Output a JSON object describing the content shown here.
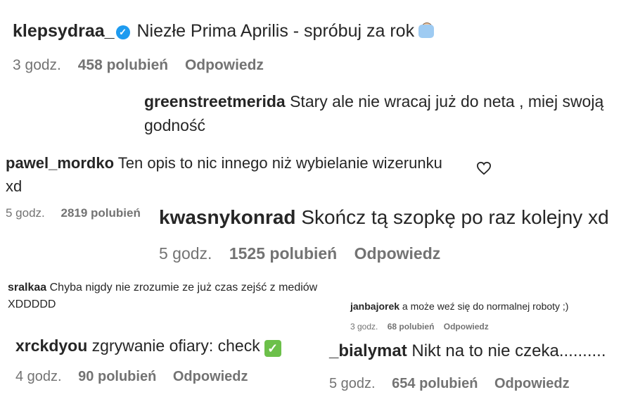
{
  "comments": [
    {
      "username": "klepsydraa_",
      "text": "Niezłe Prima Aprilis - spróbuj za rok",
      "time": "3 godz.",
      "likes": "458 polubień",
      "reply": "Odpowiedz"
    },
    {
      "username": "greenstreetmerida",
      "text_line1": "Stary ale nie wracaj już do neta , miej swoją",
      "text_line2": "godność"
    },
    {
      "username": "pawel_mordko",
      "text_line1": "Ten opis to nic innego niż wybielanie wizerunku",
      "text_line2": "xd",
      "time": "5 godz.",
      "likes": "2819 polubień"
    },
    {
      "username": "kwasnykonrad",
      "text": "Skończ tą szopkę po raz kolejny xd",
      "time": "5 godz.",
      "likes": "1525 polubień",
      "reply": "Odpowiedz"
    },
    {
      "username": "sralkaa",
      "text_line1": "Chyba nigdy nie zrozumie ze już czas zejść z mediów",
      "text_line2": "XDDDDD"
    },
    {
      "username": "janbajorek",
      "text": "a może weź się do normalnej roboty ;)",
      "time": "3 godz.",
      "likes": "68 polubień",
      "reply": "Odpowiedz"
    },
    {
      "username": "xrckdyou",
      "text": "zgrywanie ofiary: check",
      "time": "4 godz.",
      "likes": "90 polubień",
      "reply": "Odpowiedz"
    },
    {
      "username": "_bialymat",
      "text": "Nikt na to nie czeka..........",
      "time": "5 godz.",
      "likes": "654 polubień",
      "reply": "Odpowiedz"
    }
  ],
  "icons": {
    "verified": "verified-badge-icon",
    "heart": "heart-outline-icon",
    "check": "check-mark-button-emoji",
    "emoji": "facepalm-emoji"
  }
}
